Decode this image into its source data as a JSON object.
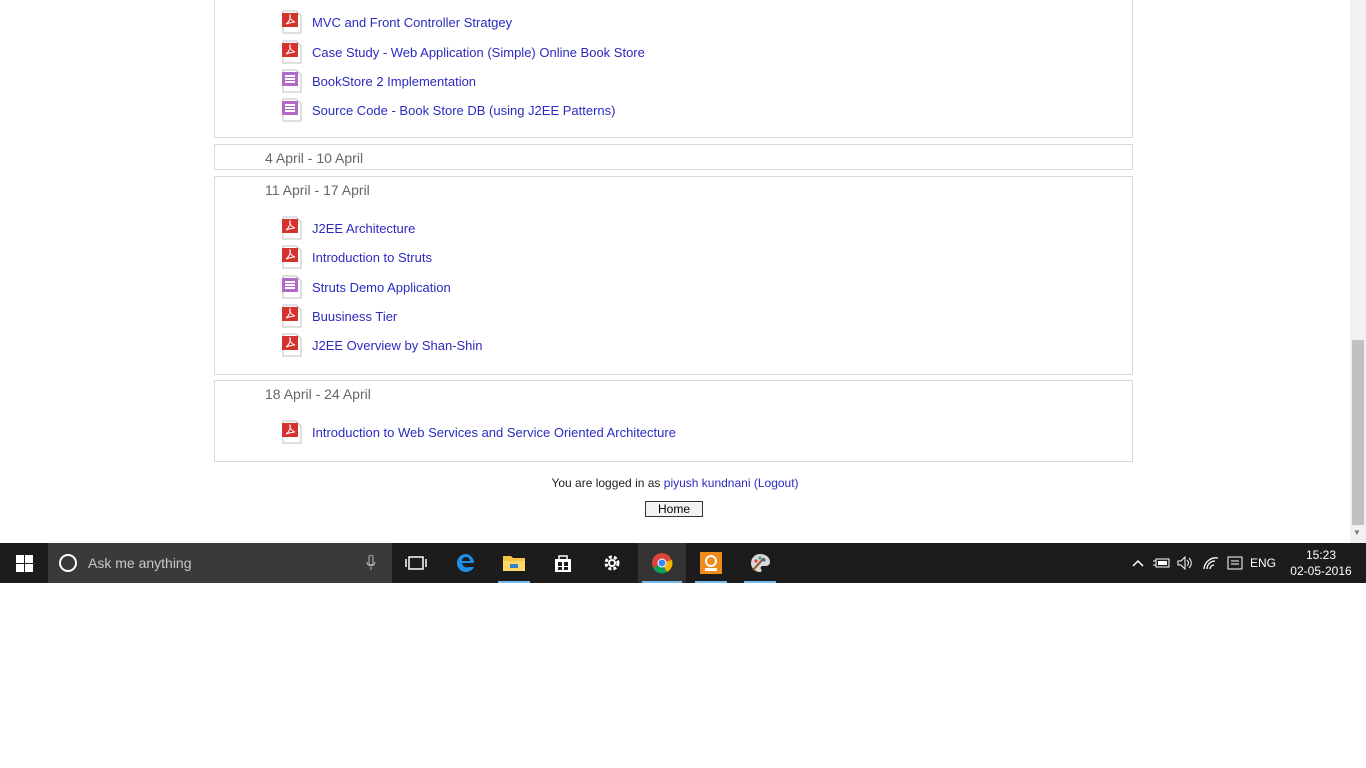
{
  "sections": [
    {
      "title": "",
      "activities": [
        {
          "type": "pdf",
          "label": "MVC and Front Controller Stratgey"
        },
        {
          "type": "pdf",
          "label": "Case Study - Web Application (Simple) Online Book Store"
        },
        {
          "type": "file",
          "label": "BookStore 2 Implementation"
        },
        {
          "type": "file",
          "label": "Source Code - Book Store DB (using J2EE Patterns)"
        }
      ]
    },
    {
      "title": "4 April - 10 April",
      "activities": []
    },
    {
      "title": "11 April - 17 April",
      "activities": [
        {
          "type": "pdf",
          "label": "J2EE Architecture"
        },
        {
          "type": "pdf",
          "label": "Introduction to Struts"
        },
        {
          "type": "file",
          "label": "Struts Demo Application"
        },
        {
          "type": "pdf",
          "label": "Buusiness Tier"
        },
        {
          "type": "pdf",
          "label": "J2EE Overview by Shan-Shin"
        }
      ]
    },
    {
      "title": "18 April - 24 April",
      "activities": [
        {
          "type": "pdf",
          "label": "Introduction to Web Services and Service Oriented Architecture"
        }
      ]
    }
  ],
  "footer": {
    "logged_in_prefix": "You are logged in as",
    "user_name": "piyush kundnani",
    "logout_label": "(Logout)",
    "home_button": "Home"
  },
  "taskbar": {
    "search_placeholder": "Ask me anything",
    "language": "ENG",
    "time": "15:23",
    "date": "02-05-2016"
  },
  "colors": {
    "link": "#2b2bc0",
    "taskbar_bg": "#1c1c1c",
    "active_underline": "#76b9ed"
  }
}
